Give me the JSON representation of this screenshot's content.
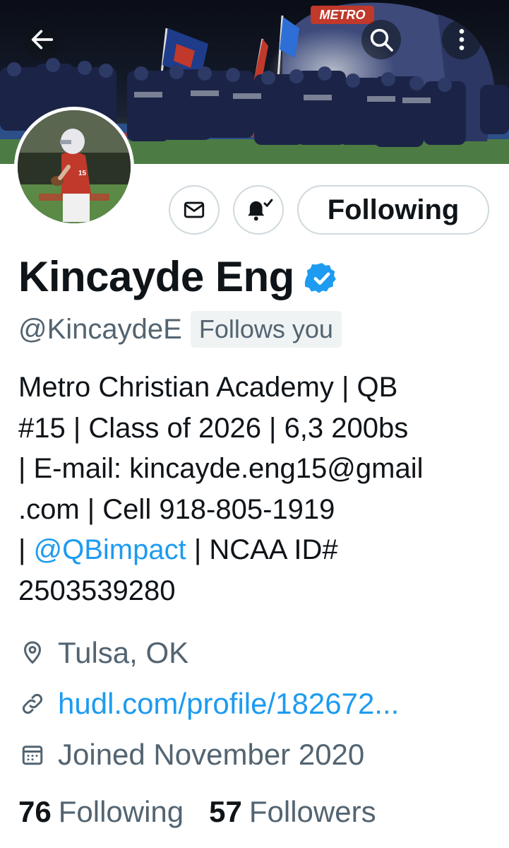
{
  "header": {
    "back_icon": "arrow-left-icon",
    "search_icon": "search-icon",
    "more_icon": "more-vertical-icon",
    "banner_sign_text": "METRO"
  },
  "actions": {
    "message_icon": "envelope-icon",
    "notify_icon": "bell-check-icon",
    "following_label": "Following"
  },
  "profile": {
    "name": "Kincayde Eng",
    "verified": true,
    "handle": "@KincaydeE",
    "follows_you": "Follows you",
    "bio": {
      "line1": "Metro Christian Academy | QB",
      "line2": "#15 | Class of 2026 | 6,3 200bs",
      "line3": "| E-mail: kincayde.eng15@gmail",
      "line4": ".com | Cell 918-805-1919",
      "line5_prefix": "| ",
      "line5_mention": "@QBimpact",
      "line5_suffix": " | NCAA ID#",
      "line6": "2503539280"
    },
    "location": "Tulsa, OK",
    "website": "hudl.com/profile/182672...",
    "joined": "Joined November 2020"
  },
  "stats": {
    "following_count": "76",
    "following_label": "Following",
    "followers_count": "57",
    "followers_label": "Followers"
  },
  "colors": {
    "accent": "#1d9bf0",
    "secondary_text": "#536471",
    "border": "#cfd9de",
    "primary_text": "#0f1419"
  }
}
